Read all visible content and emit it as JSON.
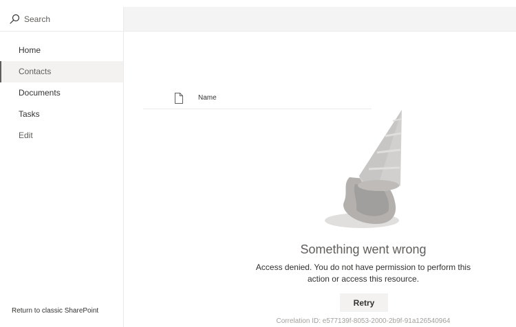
{
  "sidebar": {
    "search": {
      "placeholder": "Search"
    },
    "items": [
      {
        "label": "Home"
      },
      {
        "label": "Contacts"
      },
      {
        "label": "Documents"
      },
      {
        "label": "Tasks"
      },
      {
        "label": "Edit"
      }
    ],
    "classic_link": "Return to classic SharePoint"
  },
  "list": {
    "columns": [
      {
        "label": "Name"
      }
    ]
  },
  "error": {
    "title": "Something went wrong",
    "message": "Access denied. You do not have permission to perform this action or access this resource.",
    "retry_label": "Retry",
    "correlation": "Correlation ID: e577139f-8053-2000-2b9f-91a126540964"
  },
  "icons": {
    "search": "search-icon",
    "file": "file-icon"
  },
  "colors": {
    "active_nav_bg": "#f3f2f1",
    "command_bar_bg": "#f4f4f4",
    "text_primary": "#323130",
    "text_secondary": "#605e5c"
  }
}
